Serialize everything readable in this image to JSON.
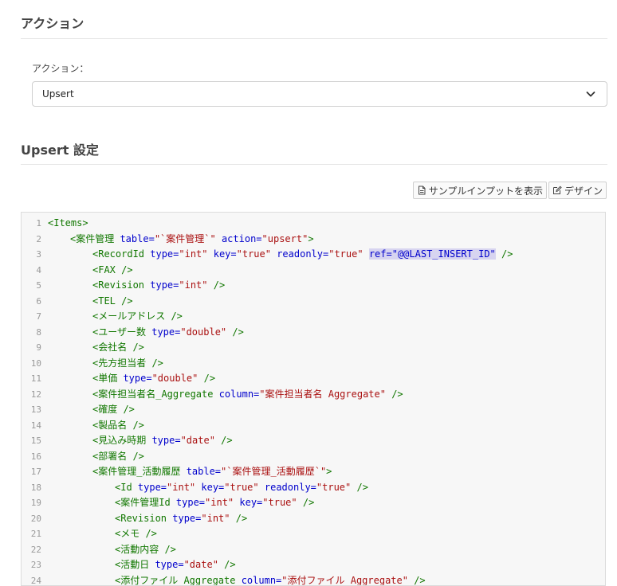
{
  "action_section": {
    "title": "アクション"
  },
  "action_field": {
    "label": "アクション：",
    "value": "Upsert"
  },
  "upsert_section": {
    "title": "Upsert 設定"
  },
  "toolbar": {
    "sample_input_label": "サンプルインプットを表示",
    "design_label": "デザイン"
  },
  "editor": {
    "highlighted_token": "ref=\"@@LAST_INSERT_ID\"",
    "lines": [
      {
        "n": "1",
        "indent": 0,
        "tokens": [
          [
            "t",
            "<Items>"
          ]
        ]
      },
      {
        "n": "2",
        "indent": 1,
        "tokens": [
          [
            "t",
            "<案件管理 "
          ],
          [
            "a",
            "table="
          ],
          [
            "v",
            "\"`案件管理`\""
          ],
          [
            "a",
            " action="
          ],
          [
            "v",
            "\"upsert\""
          ],
          [
            "t",
            ">"
          ]
        ]
      },
      {
        "n": "3",
        "indent": 2,
        "tokens": [
          [
            "t",
            "<RecordId "
          ],
          [
            "a",
            "type="
          ],
          [
            "v",
            "\"int\""
          ],
          [
            "a",
            " key="
          ],
          [
            "v",
            "\"true\""
          ],
          [
            "a",
            " readonly="
          ],
          [
            "v",
            "\"true\""
          ],
          [
            "s",
            " "
          ],
          [
            "h",
            "ref=\"@@LAST_INSERT_ID\""
          ],
          [
            "t",
            " />"
          ]
        ]
      },
      {
        "n": "4",
        "indent": 2,
        "tokens": [
          [
            "t",
            "<FAX />"
          ]
        ]
      },
      {
        "n": "5",
        "indent": 2,
        "tokens": [
          [
            "t",
            "<Revision "
          ],
          [
            "a",
            "type="
          ],
          [
            "v",
            "\"int\""
          ],
          [
            "t",
            " />"
          ]
        ]
      },
      {
        "n": "6",
        "indent": 2,
        "tokens": [
          [
            "t",
            "<TEL />"
          ]
        ]
      },
      {
        "n": "7",
        "indent": 2,
        "tokens": [
          [
            "t",
            "<メールアドレス />"
          ]
        ]
      },
      {
        "n": "8",
        "indent": 2,
        "tokens": [
          [
            "t",
            "<ユーザー数 "
          ],
          [
            "a",
            "type="
          ],
          [
            "v",
            "\"double\""
          ],
          [
            "t",
            " />"
          ]
        ]
      },
      {
        "n": "9",
        "indent": 2,
        "tokens": [
          [
            "t",
            "<会社名 />"
          ]
        ]
      },
      {
        "n": "10",
        "indent": 2,
        "tokens": [
          [
            "t",
            "<先方担当者 />"
          ]
        ]
      },
      {
        "n": "11",
        "indent": 2,
        "tokens": [
          [
            "t",
            "<単価 "
          ],
          [
            "a",
            "type="
          ],
          [
            "v",
            "\"double\""
          ],
          [
            "t",
            " />"
          ]
        ]
      },
      {
        "n": "12",
        "indent": 2,
        "tokens": [
          [
            "t",
            "<案件担当者名_Aggregate "
          ],
          [
            "a",
            "column="
          ],
          [
            "v",
            "\"案件担当者名 Aggregate\""
          ],
          [
            "t",
            " />"
          ]
        ]
      },
      {
        "n": "13",
        "indent": 2,
        "tokens": [
          [
            "t",
            "<確度 />"
          ]
        ]
      },
      {
        "n": "14",
        "indent": 2,
        "tokens": [
          [
            "t",
            "<製品名 />"
          ]
        ]
      },
      {
        "n": "15",
        "indent": 2,
        "tokens": [
          [
            "t",
            "<見込み時期 "
          ],
          [
            "a",
            "type="
          ],
          [
            "v",
            "\"date\""
          ],
          [
            "t",
            " />"
          ]
        ]
      },
      {
        "n": "16",
        "indent": 2,
        "tokens": [
          [
            "t",
            "<部署名 />"
          ]
        ]
      },
      {
        "n": "17",
        "indent": 2,
        "tokens": [
          [
            "t",
            "<案件管理_活動履歴 "
          ],
          [
            "a",
            "table="
          ],
          [
            "v",
            "\"`案件管理_活動履歴`\""
          ],
          [
            "t",
            ">"
          ]
        ]
      },
      {
        "n": "18",
        "indent": 3,
        "tokens": [
          [
            "t",
            "<Id "
          ],
          [
            "a",
            "type="
          ],
          [
            "v",
            "\"int\""
          ],
          [
            "a",
            " key="
          ],
          [
            "v",
            "\"true\""
          ],
          [
            "a",
            " readonly="
          ],
          [
            "v",
            "\"true\""
          ],
          [
            "t",
            " />"
          ]
        ]
      },
      {
        "n": "19",
        "indent": 3,
        "tokens": [
          [
            "t",
            "<案件管理Id "
          ],
          [
            "a",
            "type="
          ],
          [
            "v",
            "\"int\""
          ],
          [
            "a",
            " key="
          ],
          [
            "v",
            "\"true\""
          ],
          [
            "t",
            " />"
          ]
        ]
      },
      {
        "n": "20",
        "indent": 3,
        "tokens": [
          [
            "t",
            "<Revision "
          ],
          [
            "a",
            "type="
          ],
          [
            "v",
            "\"int\""
          ],
          [
            "t",
            " />"
          ]
        ]
      },
      {
        "n": "21",
        "indent": 3,
        "tokens": [
          [
            "t",
            "<メモ />"
          ]
        ]
      },
      {
        "n": "22",
        "indent": 3,
        "tokens": [
          [
            "t",
            "<活動内容 />"
          ]
        ]
      },
      {
        "n": "23",
        "indent": 3,
        "tokens": [
          [
            "t",
            "<活動日 "
          ],
          [
            "a",
            "type="
          ],
          [
            "v",
            "\"date\""
          ],
          [
            "t",
            " />"
          ]
        ]
      },
      {
        "n": "24",
        "indent": 3,
        "tokens": [
          [
            "t",
            "<添付ファイル_Aggregate "
          ],
          [
            "a",
            "column="
          ],
          [
            "v",
            "\"添付ファイル Aggregate\""
          ],
          [
            "t",
            " />"
          ]
        ]
      }
    ]
  }
}
